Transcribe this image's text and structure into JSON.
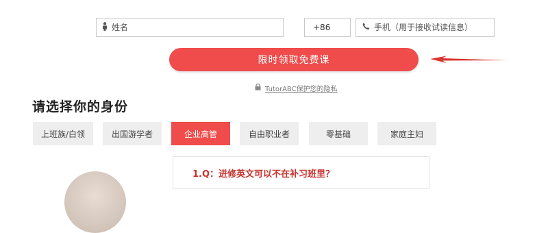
{
  "form": {
    "name_placeholder": "姓名",
    "country_code": "+86",
    "phone_placeholder": "手机（用于接收试读信息）",
    "submit_label": "限时领取免费课",
    "privacy_text": "TutorABC保护您的隐私"
  },
  "identity": {
    "title": "请选择你的身份",
    "tabs": [
      "上班族/白领",
      "出国游学者",
      "企业高管",
      "自由职业者",
      "零基础",
      "家庭主妇"
    ],
    "active_tab": "企业高管"
  },
  "faq": {
    "question": "1.Q：进修英文可以不在补习班里？"
  },
  "watermark": "",
  "colors": {
    "accent": "#ef4c4b",
    "tab_bg": "#eeeeee",
    "question_red": "#c7322e"
  },
  "icons": [
    "person-icon",
    "phone-icon",
    "lock-icon",
    "arrow-left-icon"
  ]
}
